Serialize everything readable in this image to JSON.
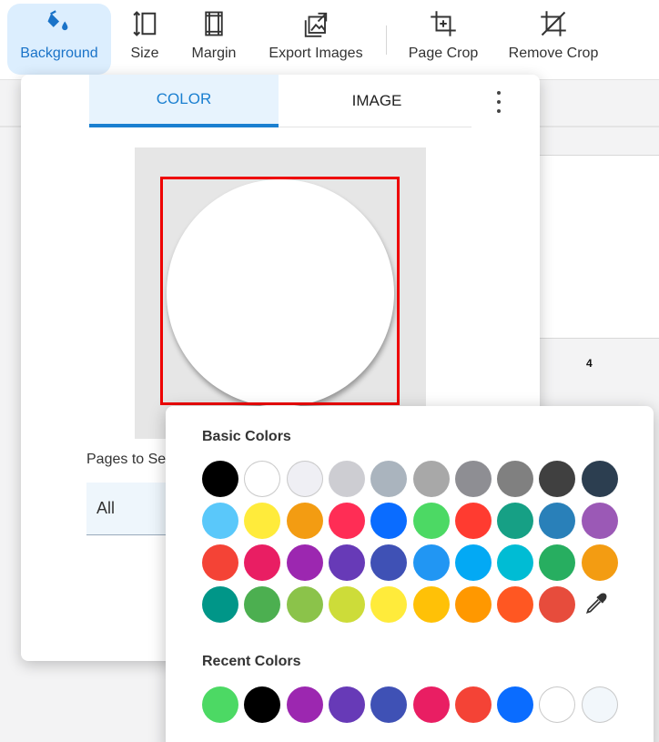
{
  "toolbar": {
    "buttons": [
      {
        "label": "Background",
        "icon": "paint-bucket-icon"
      },
      {
        "label": "Size",
        "icon": "resize-vertical-icon"
      },
      {
        "label": "Margin",
        "icon": "margin-icon"
      },
      {
        "label": "Export Images",
        "icon": "export-images-icon"
      },
      {
        "label": "Page Crop",
        "icon": "crop-icon"
      },
      {
        "label": "Remove Crop",
        "icon": "crop-off-icon"
      }
    ],
    "accent": "#1a73c8"
  },
  "document": {
    "page_number": "4"
  },
  "panel": {
    "tabs": {
      "color": "COLOR",
      "image": "IMAGE"
    },
    "pages_label": "Pages to Se",
    "pages_value": "All",
    "preview_color": "#ffffff"
  },
  "picker": {
    "basic_title": "Basic Colors",
    "recent_title": "Recent Colors",
    "basic_colors": [
      [
        "#000000",
        "#ffffff",
        "#efeff4",
        "#cdcdd2",
        "#aab4be",
        "#a8a8a8",
        "#8e8e93",
        "#808080",
        "#404040",
        "#2c3e50"
      ],
      [
        "#5ac8fa",
        "#ffeb3b",
        "#f39c12",
        "#ff2d55",
        "#0a6cff",
        "#4cd964",
        "#ff3b30",
        "#16a085",
        "#2980b9",
        "#9b59b6"
      ],
      [
        "#f44336",
        "#e91e63",
        "#9c27b0",
        "#673ab7",
        "#3f51b5",
        "#2196f3",
        "#03a9f4",
        "#00bcd4",
        "#27ae60",
        "#f39c12"
      ],
      [
        "#009688",
        "#4caf50",
        "#8bc34a",
        "#cddc39",
        "#ffeb3b",
        "#ffc107",
        "#ff9800",
        "#ff5722",
        "#e74c3c"
      ]
    ],
    "recent_colors": [
      "#4cd964",
      "#000000",
      "#9c27b0",
      "#673ab7",
      "#3f51b5",
      "#e91e63",
      "#f44336",
      "#0a6cff",
      "#ffffff",
      "#f2f7fb"
    ],
    "eyedropper_icon": "eyedropper-icon"
  }
}
